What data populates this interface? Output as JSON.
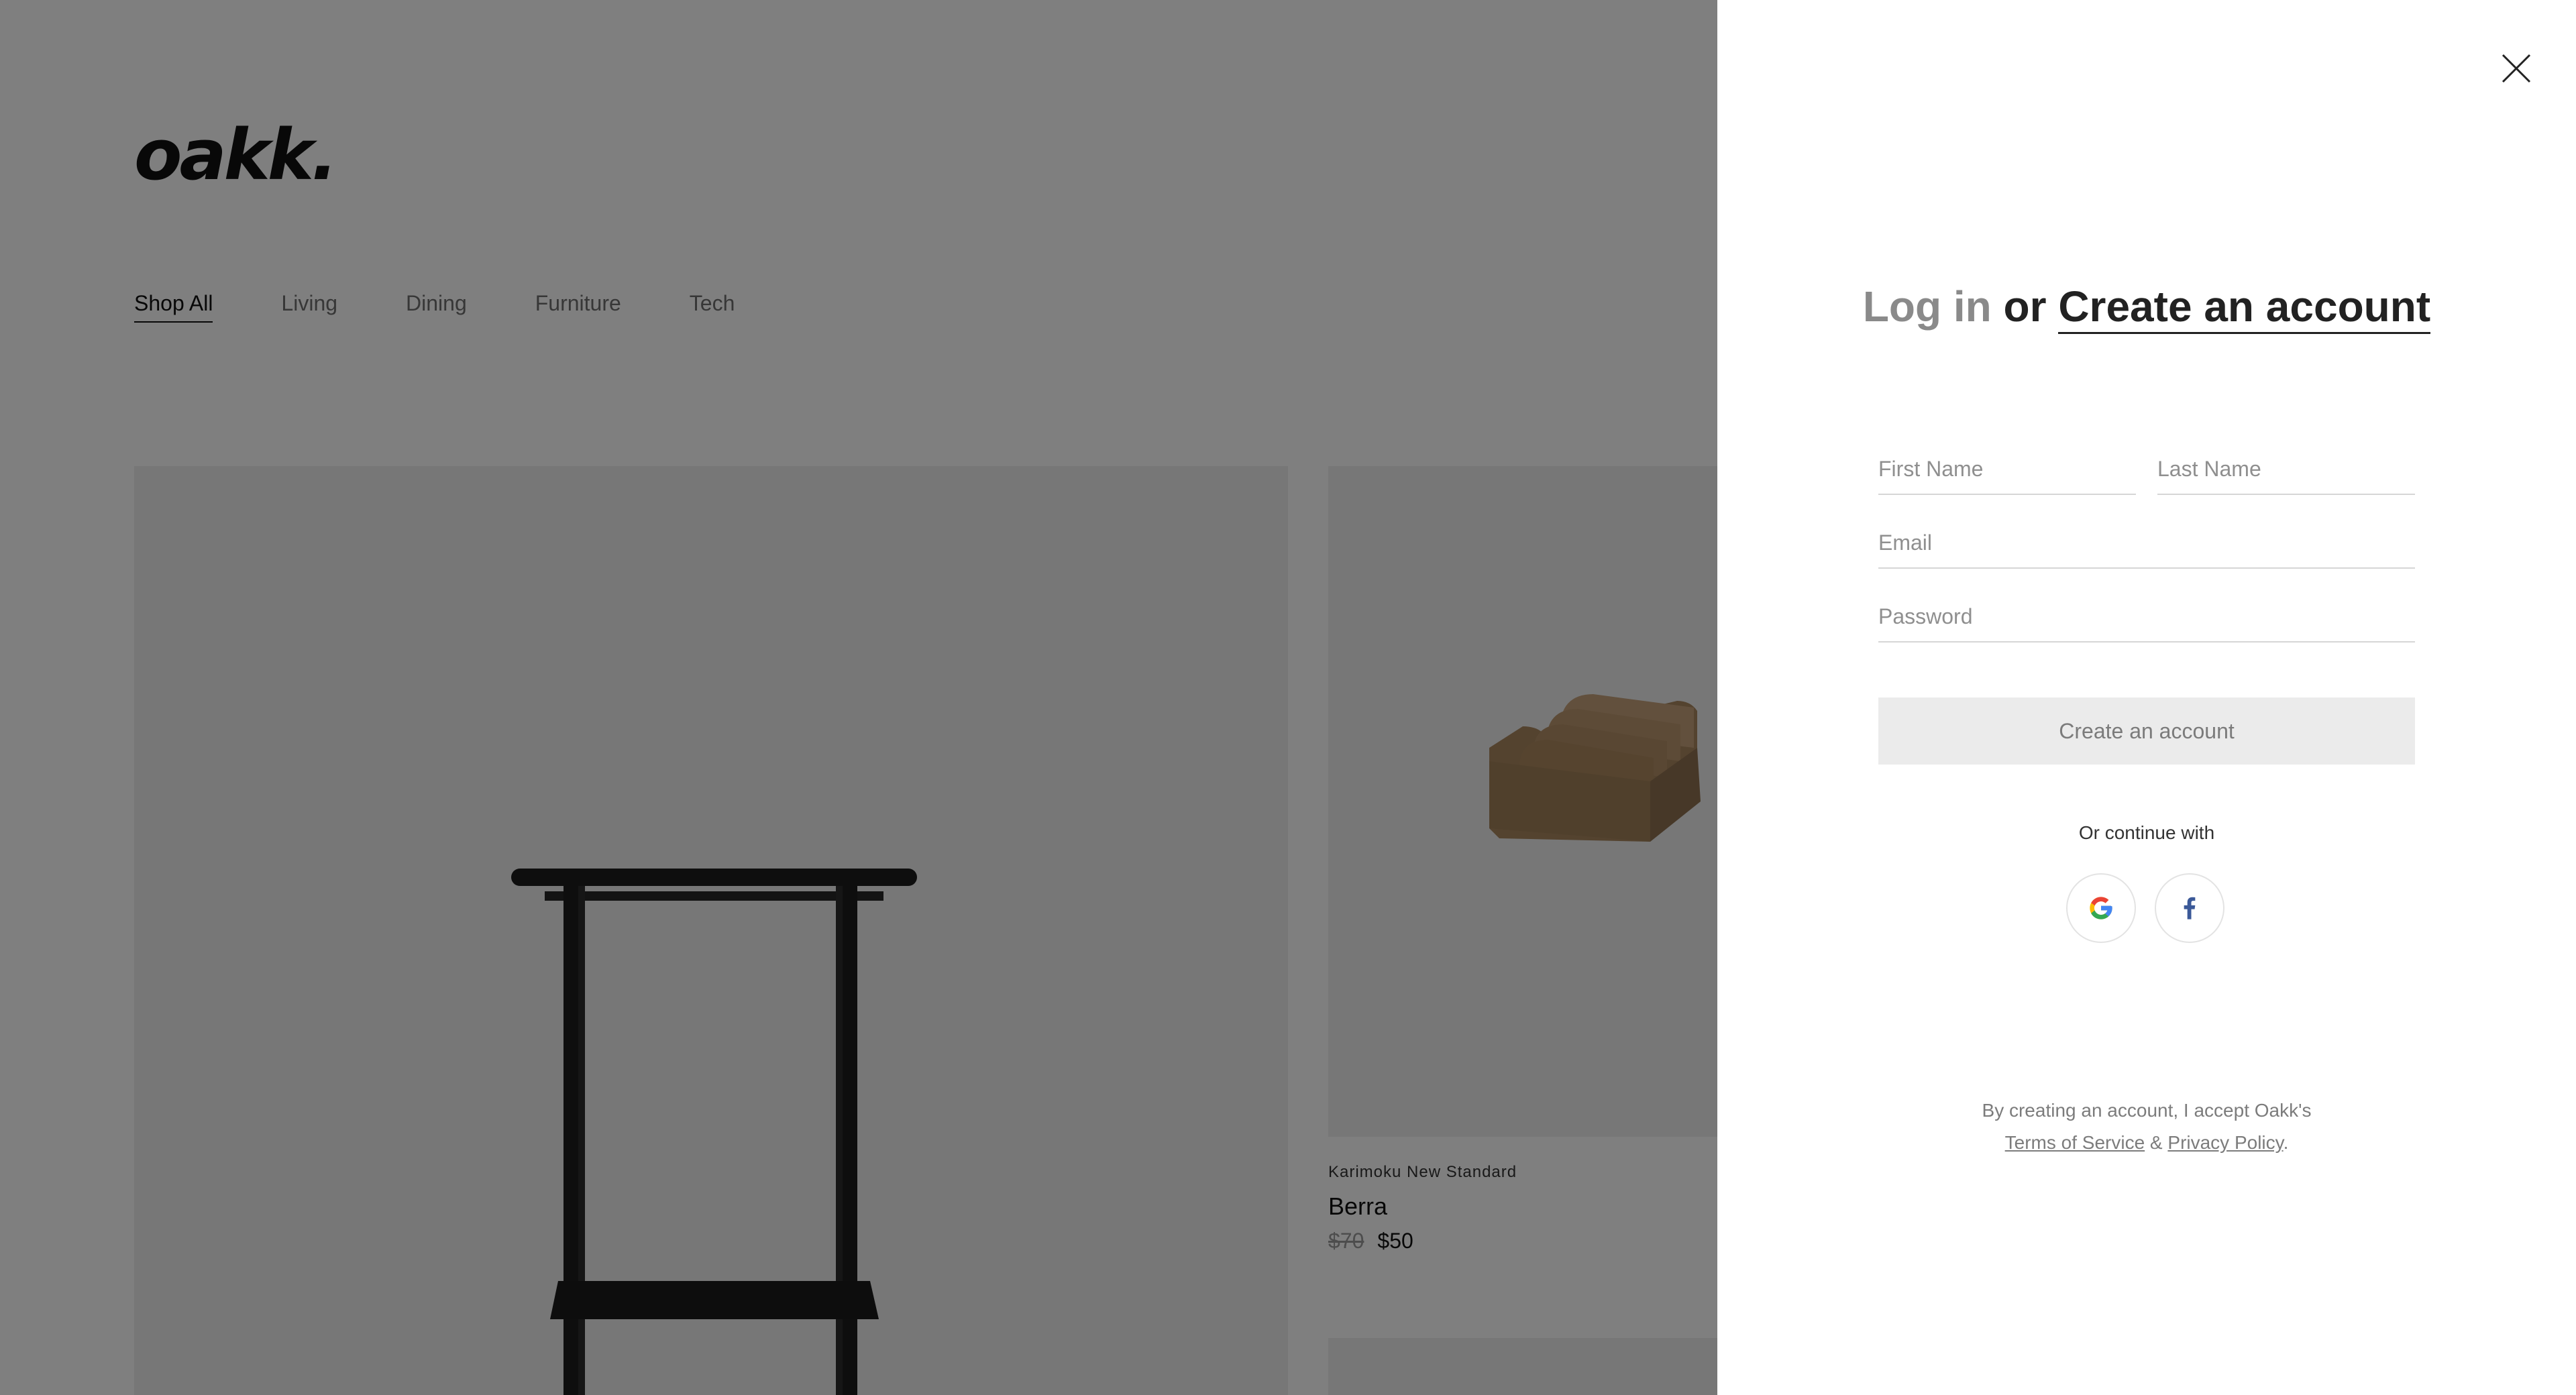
{
  "brand": {
    "logo": "oakk."
  },
  "nav": {
    "items": [
      {
        "label": "Shop All"
      },
      {
        "label": "Living"
      },
      {
        "label": "Dining"
      },
      {
        "label": "Furniture"
      },
      {
        "label": "Tech"
      }
    ]
  },
  "products": [
    {
      "brand": "Karimoku New Standard",
      "name": "Berra",
      "price_original": "$70",
      "price_sale": "$50"
    }
  ],
  "drawer": {
    "title_login": "Log in",
    "title_or": "or",
    "title_create": "Create an account",
    "fields": {
      "first_name_placeholder": "First Name",
      "last_name_placeholder": "Last Name",
      "email_placeholder": "Email",
      "password_placeholder": "Password"
    },
    "submit_label": "Create an account",
    "continue_with": "Or continue with",
    "social": [
      {
        "icon": "google-icon"
      },
      {
        "icon": "facebook-icon"
      }
    ],
    "legal": {
      "prefix": "By creating an account, I accept Oakk's",
      "terms": "Terms of Service",
      "amp": "&",
      "privacy": "Privacy Policy",
      "suffix": "."
    }
  },
  "colors": {
    "overlay": "#000000",
    "google_blue": "#4285F4",
    "google_red": "#EA4335",
    "google_yellow": "#FBBC05",
    "google_green": "#34A853",
    "facebook_blue": "#3B5998"
  }
}
